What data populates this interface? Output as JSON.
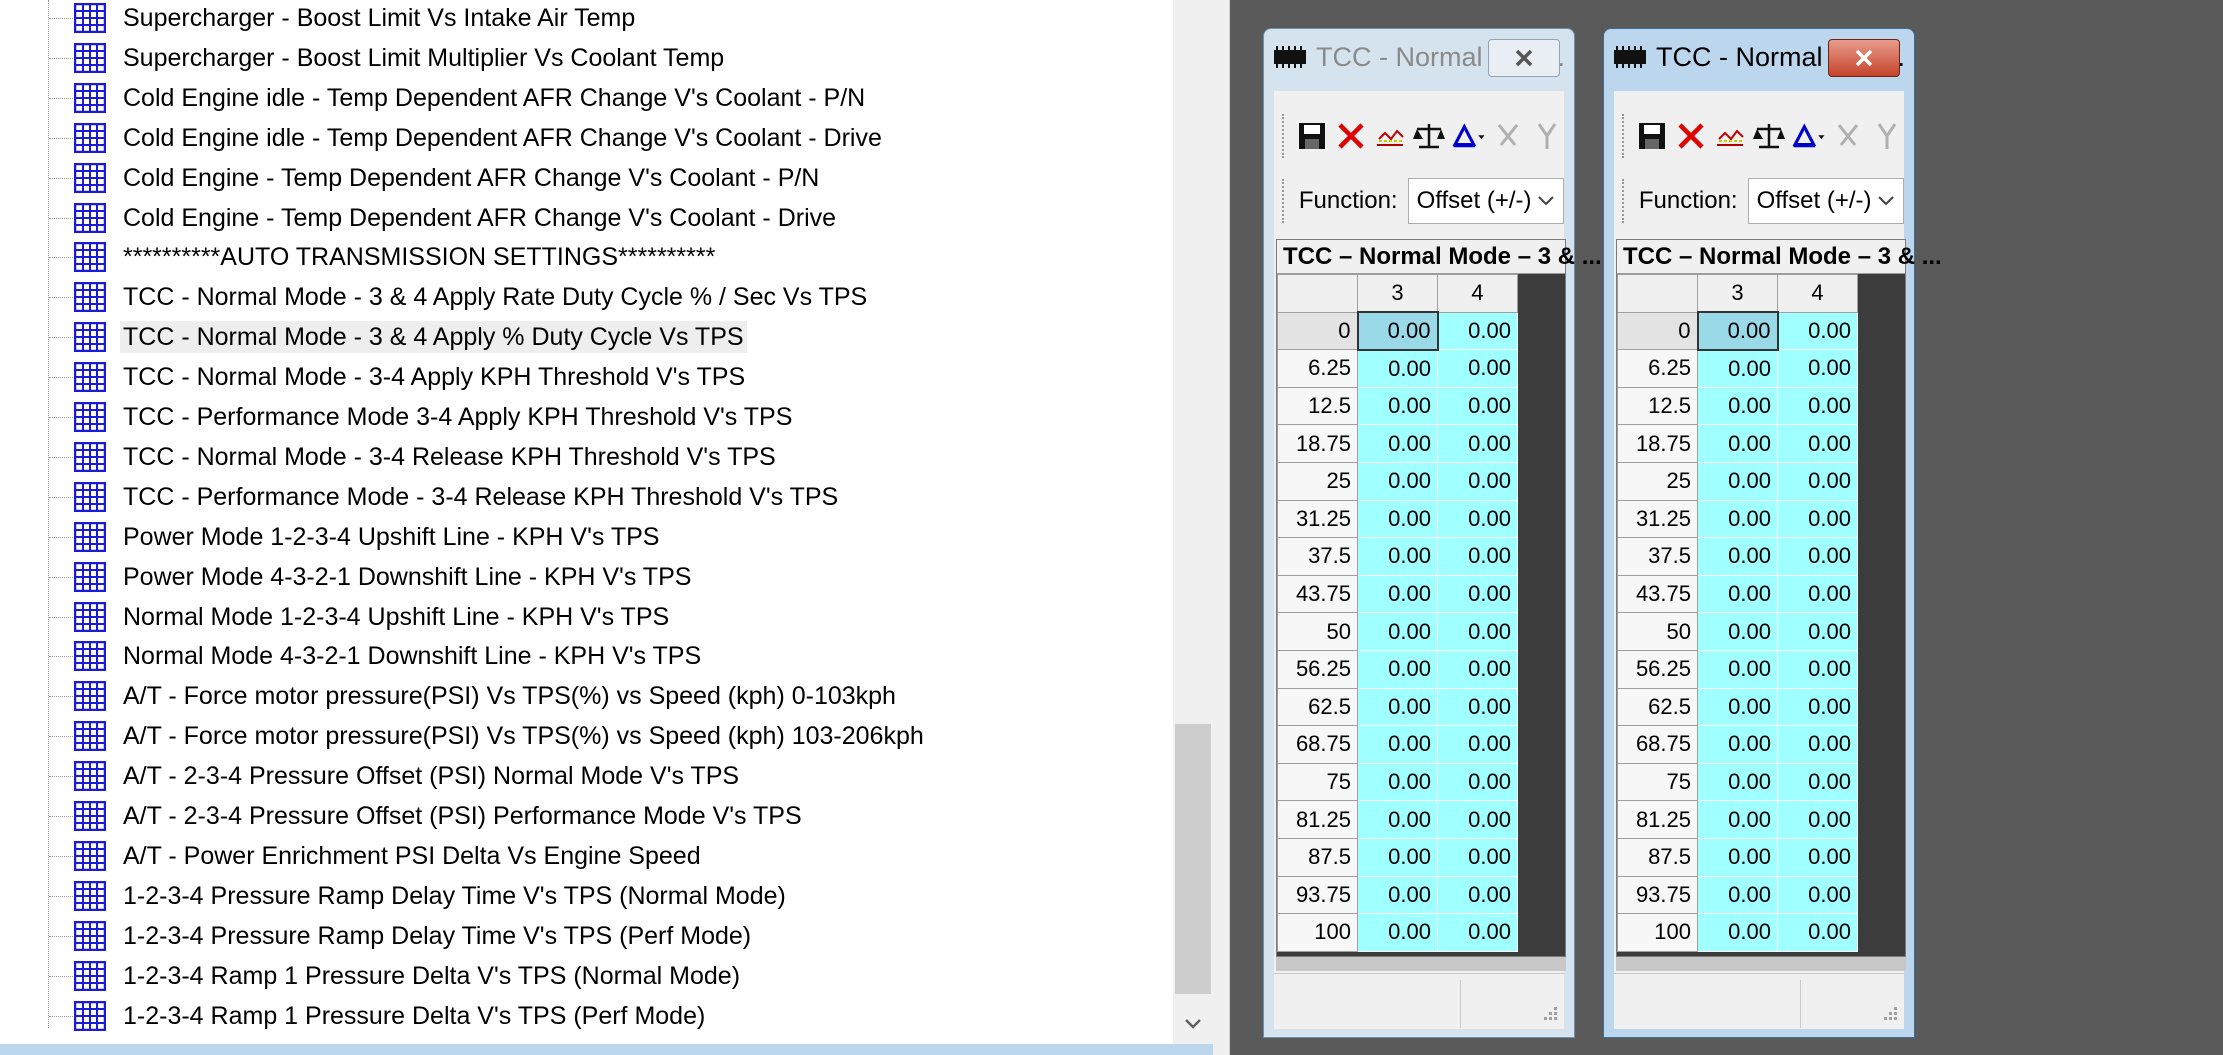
{
  "tree": {
    "items": [
      {
        "label": "Supercharger - Boost Limit Vs Intake Air Temp"
      },
      {
        "label": "Supercharger - Boost Limit Multiplier Vs Coolant Temp"
      },
      {
        "label": "Cold Engine idle - Temp Dependent AFR Change V's Coolant - P/N"
      },
      {
        "label": "Cold Engine idle - Temp Dependent AFR Change V's Coolant - Drive"
      },
      {
        "label": "Cold Engine - Temp Dependent AFR Change V's Coolant - P/N"
      },
      {
        "label": "Cold Engine - Temp Dependent AFR Change V's Coolant - Drive"
      },
      {
        "label": "**********AUTO TRANSMISSION SETTINGS**********"
      },
      {
        "label": "TCC - Normal Mode - 3 & 4 Apply Rate Duty Cycle % / Sec Vs TPS"
      },
      {
        "label": "TCC - Normal Mode - 3 & 4 Apply % Duty Cycle Vs TPS",
        "selected": true
      },
      {
        "label": "TCC - Normal Mode - 3-4 Apply KPH Threshold V's TPS"
      },
      {
        "label": "TCC - Performance Mode  3-4 Apply KPH Threshold V's TPS"
      },
      {
        "label": "TCC - Normal Mode - 3-4 Release KPH Threshold V's TPS"
      },
      {
        "label": "TCC - Performance Mode - 3-4 Release KPH Threshold V's TPS"
      },
      {
        "label": "Power Mode 1-2-3-4 Upshift Line - KPH V's TPS"
      },
      {
        "label": "Power Mode 4-3-2-1 Downshift Line - KPH V's TPS"
      },
      {
        "label": "Normal Mode 1-2-3-4 Upshift Line - KPH V's TPS"
      },
      {
        "label": "Normal Mode 4-3-2-1 Downshift Line - KPH V's TPS"
      },
      {
        "label": "A/T -  Force motor pressure(PSI) Vs TPS(%) vs Speed (kph) 0-103kph"
      },
      {
        "label": "A/T -  Force motor pressure(PSI) Vs TPS(%) vs Speed (kph) 103-206kph"
      },
      {
        "label": "A/T - 2-3-4 Pressure Offset (PSI) Normal Mode V's TPS"
      },
      {
        "label": "A/T - 2-3-4 Pressure Offset (PSI) Performance Mode V's TPS"
      },
      {
        "label": "A/T - Power Enrichment PSI Delta Vs Engine Speed"
      },
      {
        "label": "1-2-3-4 Pressure Ramp Delay Time V's TPS (Normal Mode)"
      },
      {
        "label": "1-2-3-4 Pressure Ramp Delay Time V's TPS (Perf Mode)"
      },
      {
        "label": "1-2-3-4 Ramp 1 Pressure Delta V's TPS (Normal Mode)"
      },
      {
        "label": "1-2-3-4 Ramp 1 Pressure Delta V's TPS (Perf Mode)"
      }
    ]
  },
  "windows": [
    {
      "title": "TCC - Normal Mod...",
      "active": false,
      "function_label": "Function:",
      "function_value": "Offset (+/-)",
      "grid_title": "TCC – Normal Mode – 3 & ...",
      "columns": [
        "3",
        "4"
      ],
      "rows": [
        "0",
        "6.25",
        "12.5",
        "18.75",
        "25",
        "31.25",
        "37.5",
        "43.75",
        "50",
        "56.25",
        "62.5",
        "68.75",
        "75",
        "81.25",
        "87.5",
        "93.75",
        "100"
      ],
      "cell_value": "0.00"
    },
    {
      "title": "TCC - Normal Mod...",
      "active": true,
      "function_label": "Function:",
      "function_value": "Offset (+/-)",
      "grid_title": "TCC – Normal Mode – 3 & ...",
      "columns": [
        "3",
        "4"
      ],
      "rows": [
        "0",
        "6.25",
        "12.5",
        "18.75",
        "25",
        "31.25",
        "37.5",
        "43.75",
        "50",
        "56.25",
        "62.5",
        "68.75",
        "75",
        "81.25",
        "87.5",
        "93.75",
        "100"
      ],
      "cell_value": "0.00"
    }
  ],
  "icons": {
    "tree_item": "table-grid-icon",
    "window": "chip-icon",
    "toolbar": [
      "save-icon",
      "delete-icon",
      "graph-icon",
      "scale-icon",
      "delta-icon",
      "cut-icon",
      "y-icon"
    ]
  },
  "colors": {
    "cell_bg": "#a0ffff",
    "mdi_bg": "#5a5a5a",
    "close_active": "#c6442b"
  }
}
